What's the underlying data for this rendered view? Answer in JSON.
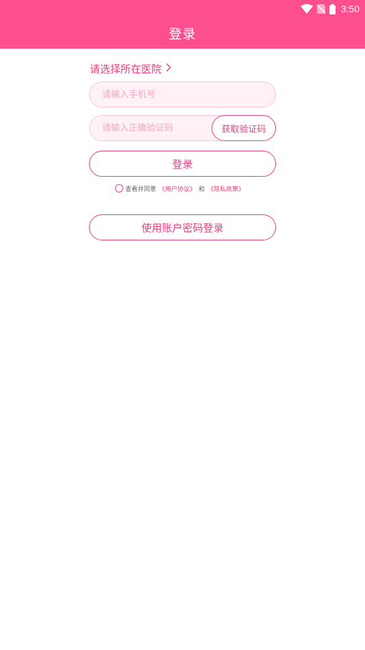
{
  "status_bar": {
    "time": "3:50",
    "icons": [
      "wifi-icon",
      "no-sim-icon",
      "battery-icon"
    ]
  },
  "header": {
    "title": "登录"
  },
  "hospital_select": {
    "label": "请选择所在医院",
    "icon": "chevron-right-icon"
  },
  "form": {
    "phone_placeholder": "请输入手机号",
    "phone_value": "",
    "code_placeholder": "请输入正确验证码",
    "code_value": "",
    "get_code_label": "获取验证码",
    "login_label": "登录"
  },
  "agreement": {
    "prefix": "查看并同意",
    "user_agreement": "《用户协议》",
    "conjunction": "和",
    "privacy_policy": "《隐私政策》"
  },
  "account_login_label": "使用账户密码登录",
  "colors": {
    "primary": "#fd4e8e",
    "accent_text": "#e8417f",
    "field_bg": "#fff1f5",
    "field_border": "#f7c7d8",
    "placeholder": "#f4a7c2"
  }
}
